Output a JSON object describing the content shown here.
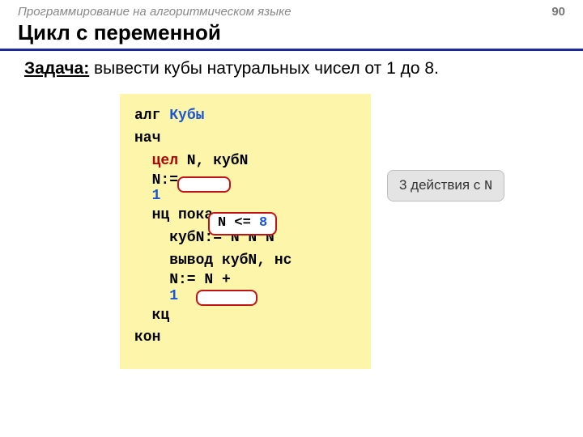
{
  "header": {
    "course": "Программирование на алгоритмическом языке",
    "page": "90"
  },
  "title": "Цикл с переменной",
  "task": {
    "label": "Задача:",
    "text": " вывести кубы натуральных чисел от 1 до 8."
  },
  "code": {
    "kw_alg": "алг ",
    "alg_name": "Кубы",
    "kw_begin": "нач",
    "kw_int": "цел",
    "vars": " N, кубN",
    "assign1a": "N:= ",
    "assign1b": "1",
    "loop_kw": "нц пока ",
    "cond_var": "N ",
    "cond_op": "<= ",
    "cond_val": "8",
    "cube": "кубN:= N*N*N",
    "out": "вывод кубN, нс",
    "inc_a": "N:= N + ",
    "inc_b": "1",
    "kw_end_loop": "кц",
    "kw_end": "кон"
  },
  "annotation": {
    "text_a": "3 действия с ",
    "text_b": "N"
  }
}
